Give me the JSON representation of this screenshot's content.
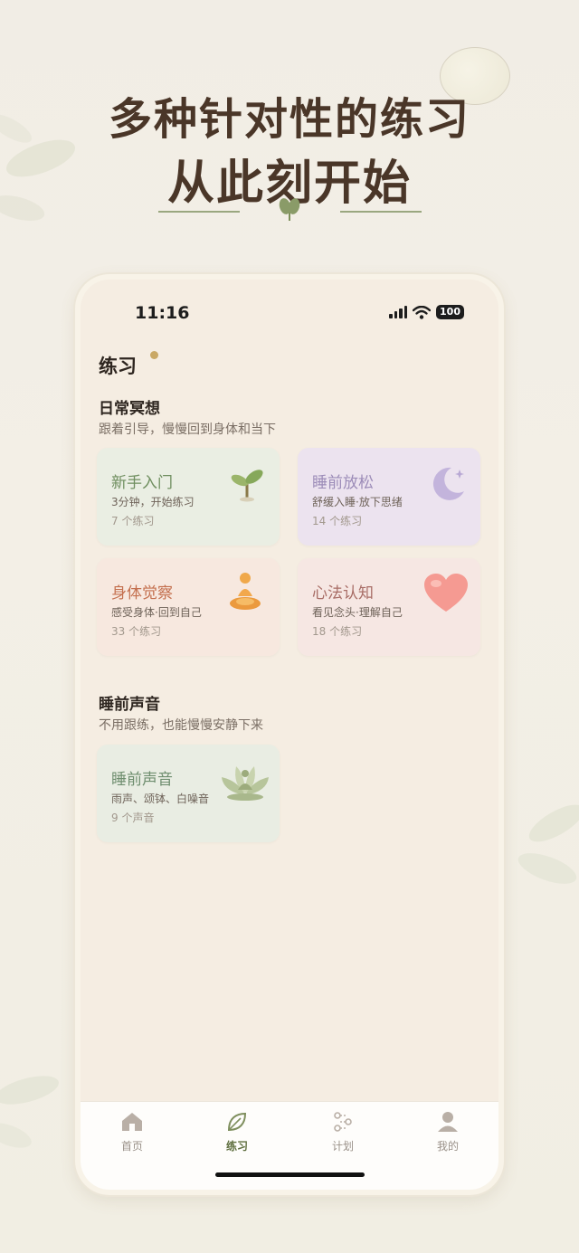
{
  "headline": {
    "line1": "多种针对性的练习",
    "line2": "从此刻开始"
  },
  "status": {
    "time": "11:16",
    "battery": "100"
  },
  "page_title": "练习",
  "daily": {
    "title": "日常冥想",
    "subtitle": "跟着引导，慢慢回到身体和当下",
    "cards": [
      {
        "title": "新手入门",
        "desc": "3分钟，开始练习",
        "count": "7 个练习",
        "icon": "sprout-icon",
        "title_color": "#6f8e5f",
        "bg": "#ebeee2"
      },
      {
        "title": "睡前放松",
        "desc": "舒缓入睡·放下思绪",
        "count": "14 个练习",
        "icon": "moon-icon",
        "title_color": "#9c8cb8",
        "bg": "#ece3ee"
      },
      {
        "title": "身体觉察",
        "desc": "感受身体·回到自己",
        "count": "33 个练习",
        "icon": "meditating-person-icon",
        "title_color": "#c4704f",
        "bg": "#f7e8df"
      },
      {
        "title": "心法认知",
        "desc": "看见念头·理解自己",
        "count": "18 个练习",
        "icon": "heart-icon",
        "title_color": "#a86d66",
        "bg": "#f6e7e2"
      }
    ]
  },
  "sleep": {
    "title": "睡前声音",
    "subtitle": "不用跟练，也能慢慢安静下来",
    "cards": [
      {
        "title": "睡前声音",
        "desc": "雨声、颂钵、白噪音",
        "count": "9 个声音",
        "icon": "lotus-meditation-icon",
        "title_color": "#6f8e6f",
        "bg": "#eaede3"
      }
    ]
  },
  "tabs": [
    {
      "label": "首页",
      "icon": "home-icon",
      "active": false
    },
    {
      "label": "练习",
      "icon": "leaf-icon",
      "active": true
    },
    {
      "label": "计划",
      "icon": "plan-icon",
      "active": false
    },
    {
      "label": "我的",
      "icon": "profile-icon",
      "active": false
    }
  ],
  "colors": {
    "accent": "#5f6f3f",
    "headline": "#4a3628",
    "screen_bg": "#f5ede2"
  }
}
